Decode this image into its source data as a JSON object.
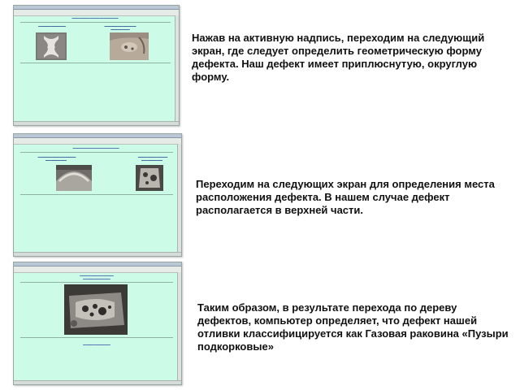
{
  "steps": [
    {
      "description": "Нажав на активную надпись, переходим на следующий экран, где следует определить геометрическую форму дефекта. Наш дефект имеет приплюснутую, округлую форму."
    },
    {
      "description": "Переходим на следующих экран для определения места расположения дефекта. В нашем случае дефект располагается в верхней части."
    },
    {
      "description": "Таким образом, в результате перехода по дереву дефектов, компьютер определяет, что дефект нашей отливки классифицируется как Газовая раковина «Пузыри подкорковые»"
    }
  ]
}
